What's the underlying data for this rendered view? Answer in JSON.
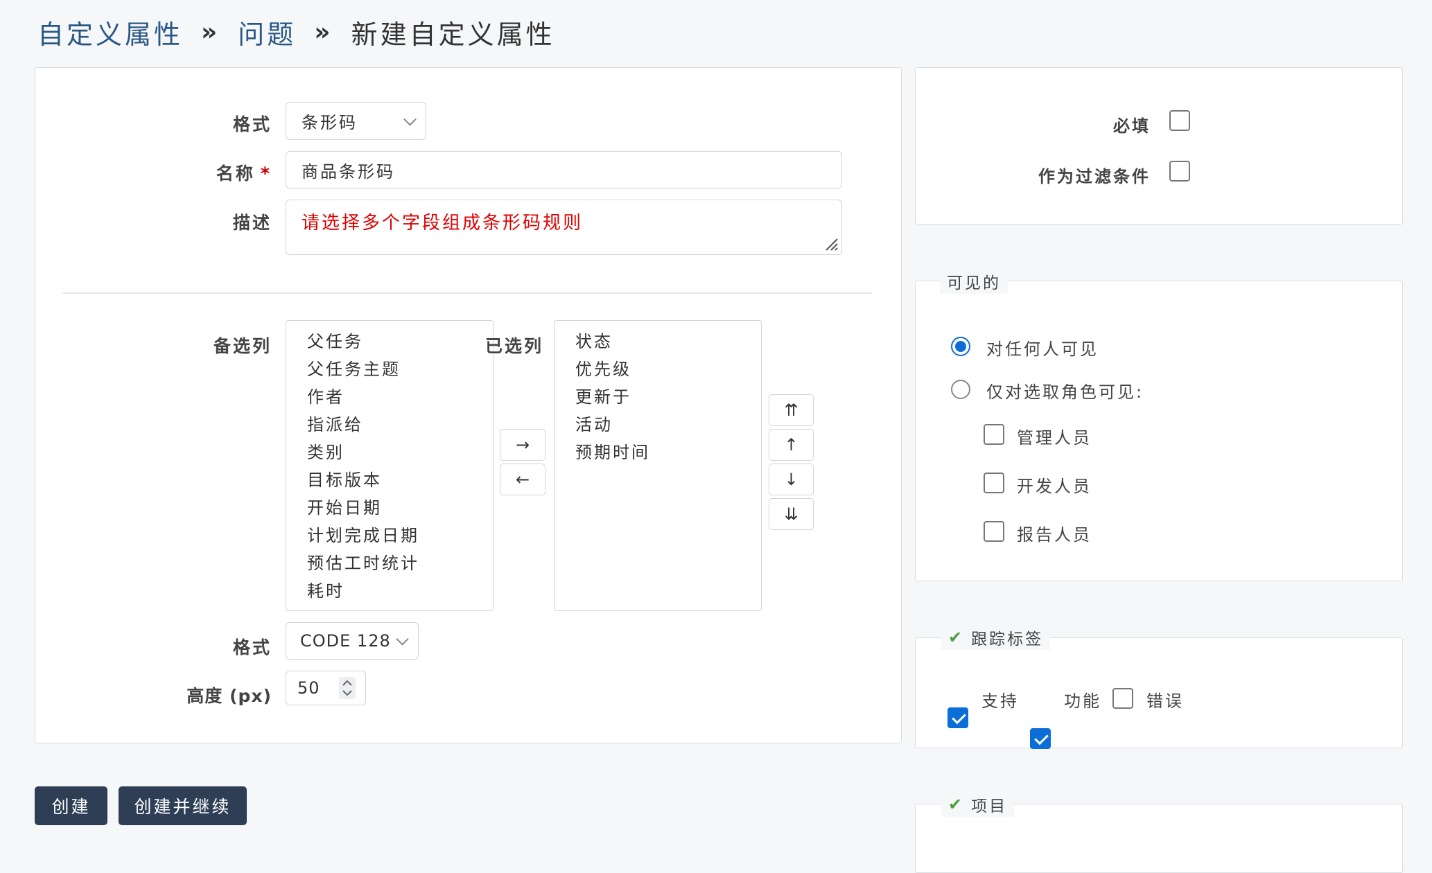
{
  "breadcrumb": {
    "items": [
      "自定义属性",
      "问题"
    ],
    "separator": "»",
    "current": "新建自定义属性"
  },
  "form": {
    "format_label": "格式",
    "format_value": "条形码",
    "name_label": "名称",
    "name_required": "*",
    "name_value": "商品条形码",
    "description_label": "描述",
    "description_value": "请选择多个字段组成条形码规则",
    "available_label": "备选列",
    "available_items": [
      "父任务",
      "父任务主题",
      "作者",
      "指派给",
      "类别",
      "目标版本",
      "开始日期",
      "计划完成日期",
      "预估工时统计",
      "耗时"
    ],
    "selected_label": "已选列",
    "selected_items": [
      "状态",
      "优先级",
      "更新于",
      "活动",
      "预期时间"
    ],
    "move_right": "→",
    "move_left": "←",
    "move_top": "⇈",
    "move_up": "↑",
    "move_down": "↓",
    "move_bottom": "⇊",
    "barcode_format_label": "格式",
    "barcode_format_value": "CODE 128",
    "height_label": "高度 (px)",
    "height_value": "50"
  },
  "options": {
    "required_label": "必填",
    "required_checked": false,
    "filter_label": "作为过滤条件",
    "filter_checked": false
  },
  "visibility": {
    "legend": "可见的",
    "anyone_label": "对任何人可见",
    "roles_label": "仅对选取角色可见:",
    "roles": [
      "管理人员",
      "开发人员",
      "报告人员"
    ]
  },
  "trackers": {
    "legend": "跟踪标签",
    "items": [
      {
        "label": "支持",
        "checked": true
      },
      {
        "label": "功能",
        "checked": true
      },
      {
        "label": "错误",
        "checked": false
      }
    ]
  },
  "projects": {
    "legend": "项目"
  },
  "actions": {
    "create": "创建",
    "create_continue": "创建并继续"
  },
  "colors": {
    "link": "#2a5885",
    "description_text": "#e00000",
    "accent": "#0b6ed8",
    "button": "#2e3f55",
    "tick": "#4aa03f"
  }
}
